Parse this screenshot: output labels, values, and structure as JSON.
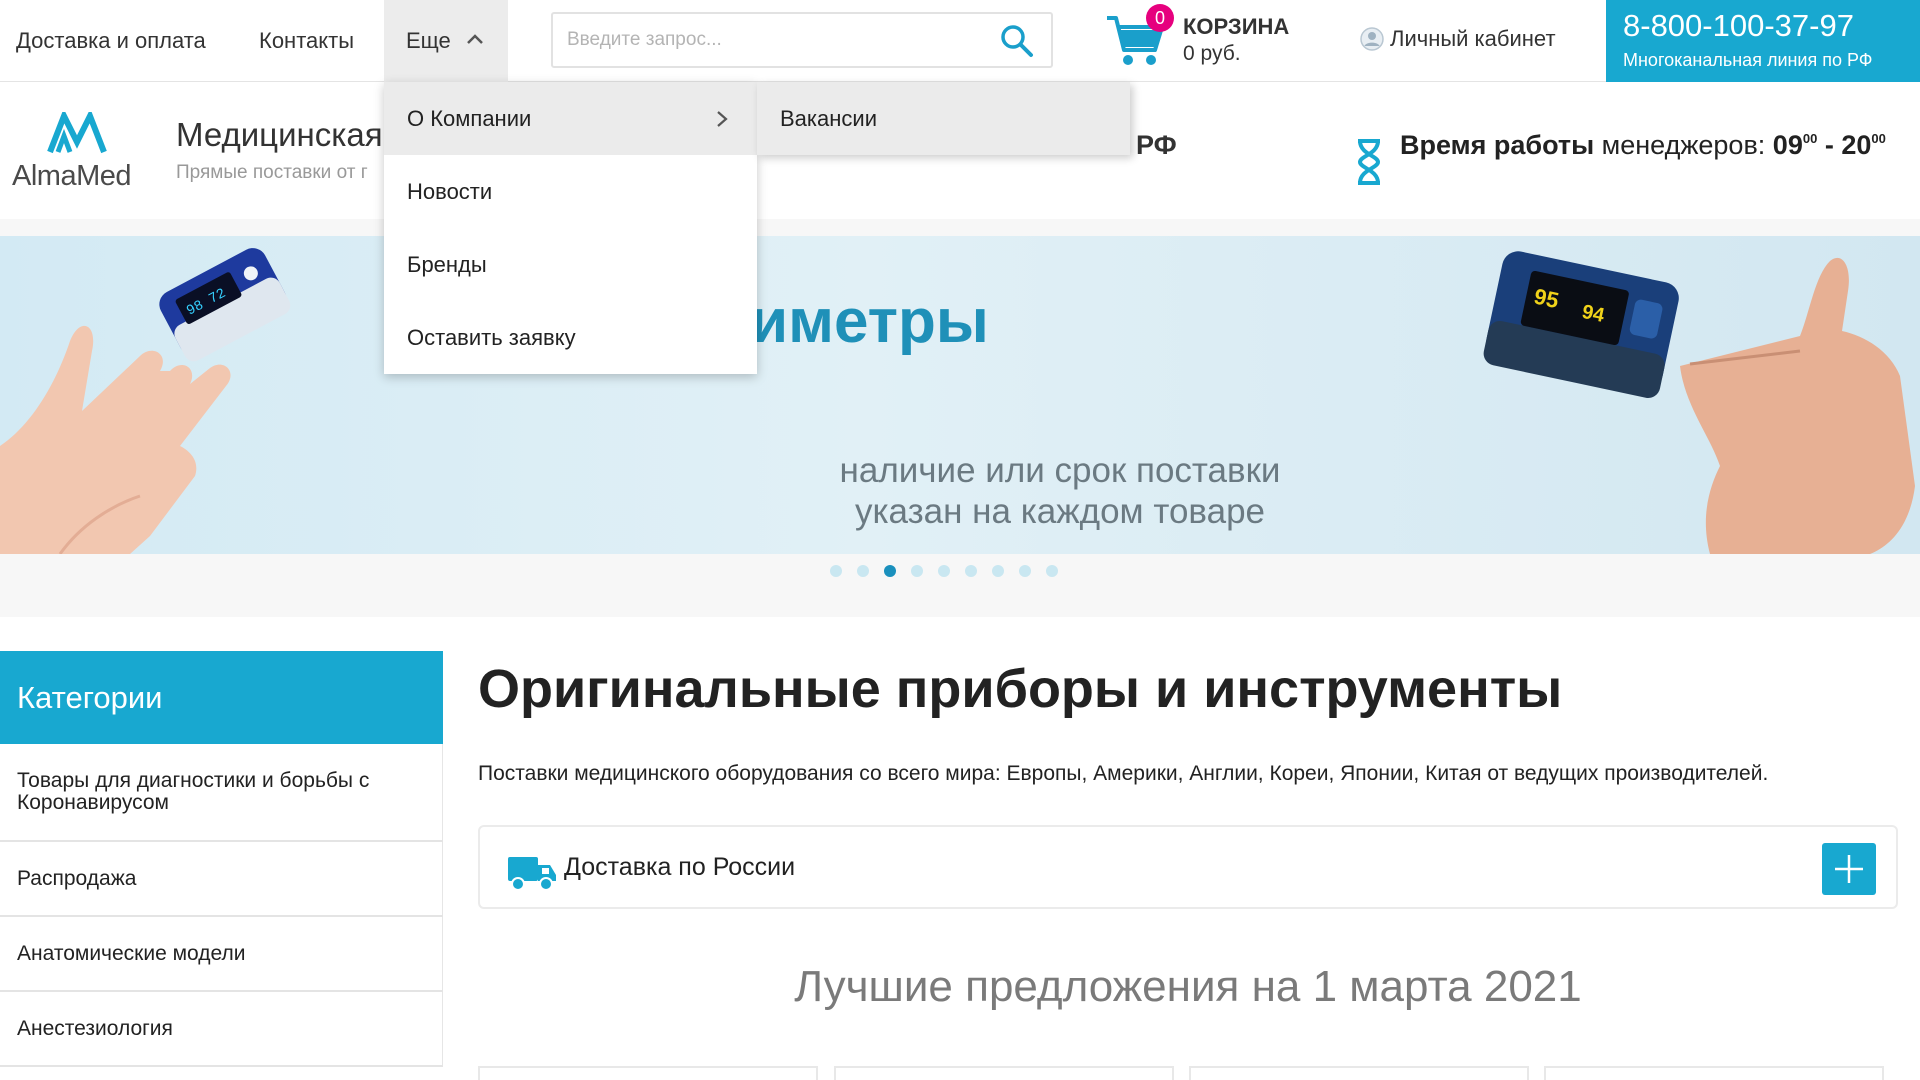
{
  "topnav": {
    "delivery": "Доставка и оплата",
    "contacts": "Контакты",
    "more": "Еще"
  },
  "search": {
    "placeholder": "Введите запрос..."
  },
  "cart": {
    "count": "0",
    "title": "КОРЗИНА",
    "sum": "0 руб."
  },
  "account": {
    "label": "Личный кабинет"
  },
  "phone": {
    "number": "8-800-100-37-97",
    "subtitle": "Многоканальная линия по РФ"
  },
  "dropdown": {
    "items": [
      "О Компании",
      "Новости",
      "Бренды",
      "Оставить заявку"
    ],
    "submenu": [
      "Вакансии"
    ]
  },
  "header": {
    "logo": "AlmaMed",
    "brand": "Медицинская",
    "brand_sub": "Прямые поставки от г",
    "rf": "РФ",
    "hours_bold": "Время работы",
    "hours_rest": " менеджеров: ",
    "hours_from": "09",
    "hours_from_min": "00",
    "hours_sep": " - ",
    "hours_to": "20",
    "hours_to_min": "00"
  },
  "banner": {
    "title": "иметры",
    "text_line1": "наличие или срок поставки",
    "text_line2": "указан на каждом товаре",
    "slides": 9,
    "active_slide": 3
  },
  "sidebar": {
    "title": "Категории",
    "items": [
      "Товары для диагностики и борьбы с Коронавирусом",
      "Распродажа",
      "Анатомические модели",
      "Анестезиология"
    ]
  },
  "main": {
    "title": "Оригинальные приборы и инструменты",
    "intro": "Поставки медицинского оборудования со всего мира: Европы, Америки, Англии, Кореи, Японии, Китая от ведущих производителей.",
    "delivery": "Доставка по России",
    "offers": "Лучшие предложения на 1 марта 2021"
  },
  "colors": {
    "accent": "#18a8d0",
    "badge": "#e6007e",
    "dot_active": "#1a90bd",
    "dot_inactive": "#c9e7f1"
  },
  "icons": {
    "search": "search-icon",
    "cart": "cart-icon",
    "user": "user-icon",
    "chevron_up": "chevron-up-icon",
    "chevron_right": "chevron-right-icon",
    "hourglass": "hourglass-icon",
    "truck": "truck-icon",
    "plus": "plus-icon"
  }
}
